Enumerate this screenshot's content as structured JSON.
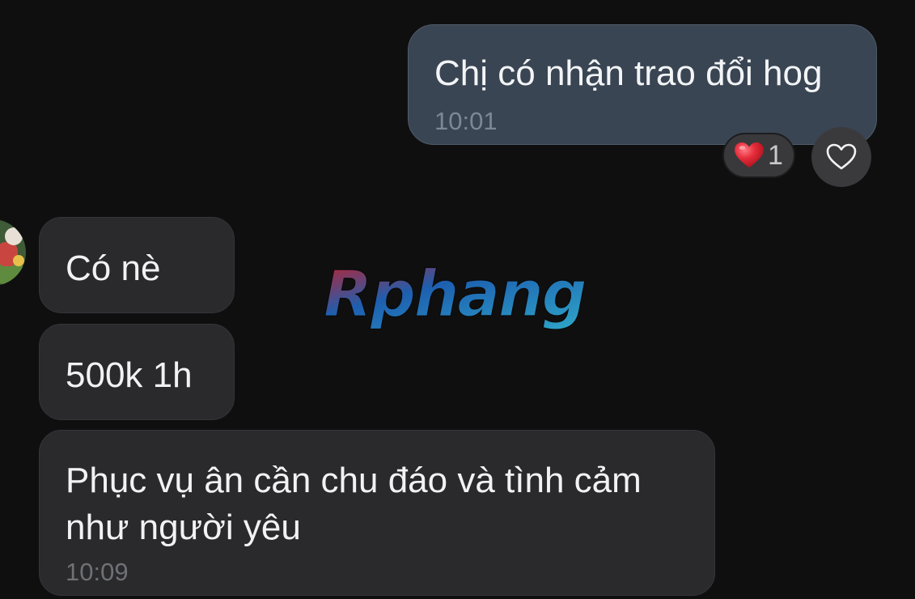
{
  "outgoing": {
    "text": "Chị có nhận trao đổi hog",
    "time": "10:01",
    "reaction": {
      "emoji": "heart-red",
      "count": "1"
    }
  },
  "incoming": [
    {
      "text": "Có nè"
    },
    {
      "text": "500k 1h"
    },
    {
      "lines": [
        "Phục vụ ân cần chu đáo và tình cảm",
        "như người yêu"
      ],
      "time": "10:09"
    }
  ],
  "watermark": {
    "text": "Rphang",
    "colors": {
      "start": "#c81e28",
      "mid": "#1d5fb0",
      "end": "#2fa8c9"
    }
  },
  "colors": {
    "background": "#0f0f10",
    "outgoing_bubble": "#3a4553",
    "incoming_bubble": "#2a2a2d",
    "heart": "#e52d3b"
  }
}
